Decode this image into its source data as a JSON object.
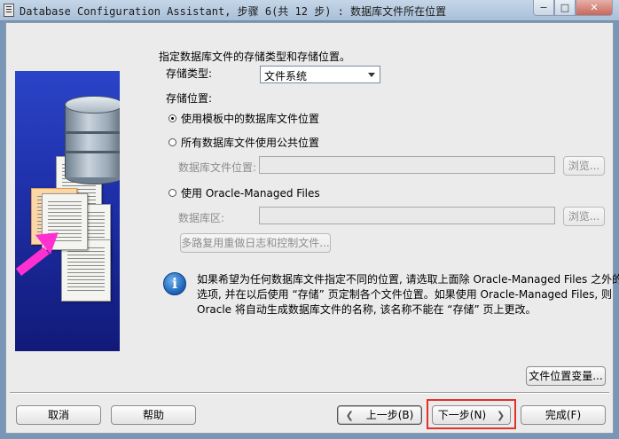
{
  "window": {
    "title": "Database Configuration Assistant, 步骤 6(共 12 步) : 数据库文件所在位置",
    "minimize_glyph": "−",
    "maximize_glyph": "□",
    "close_glyph": "✕"
  },
  "form": {
    "intro": "指定数据库文件的存储类型和存储位置。",
    "storage_type_label": "存储类型:",
    "storage_type_value": "文件系统",
    "storage_location_label": "存储位置:",
    "options": {
      "template": "使用模板中的数据库文件位置",
      "common": "所有数据库文件使用公共位置",
      "omf": "使用 Oracle-Managed Files"
    },
    "db_file_location_label": "数据库文件位置:",
    "db_area_label": "数据库区:",
    "browse_label": "浏览...",
    "multiplex_button": "多路复用重做日志和控制文件...",
    "info_lines": [
      "如果希望为任何数据库文件指定不同的位置, 请选取上面除 Oracle-Managed Files 之外的任意",
      "选项, 并在以后使用 “存储” 页定制各个文件位置。如果使用 Oracle-Managed Files, 则",
      "Oracle 将自动生成数据库文件的名称, 该名称不能在 “存储” 页上更改。"
    ],
    "file_location_vars_button": "文件位置变量..."
  },
  "footer": {
    "cancel": "取消",
    "help": "帮助",
    "back": "上一步(B)",
    "next": "下一步(N)",
    "finish": "完成(F)"
  }
}
